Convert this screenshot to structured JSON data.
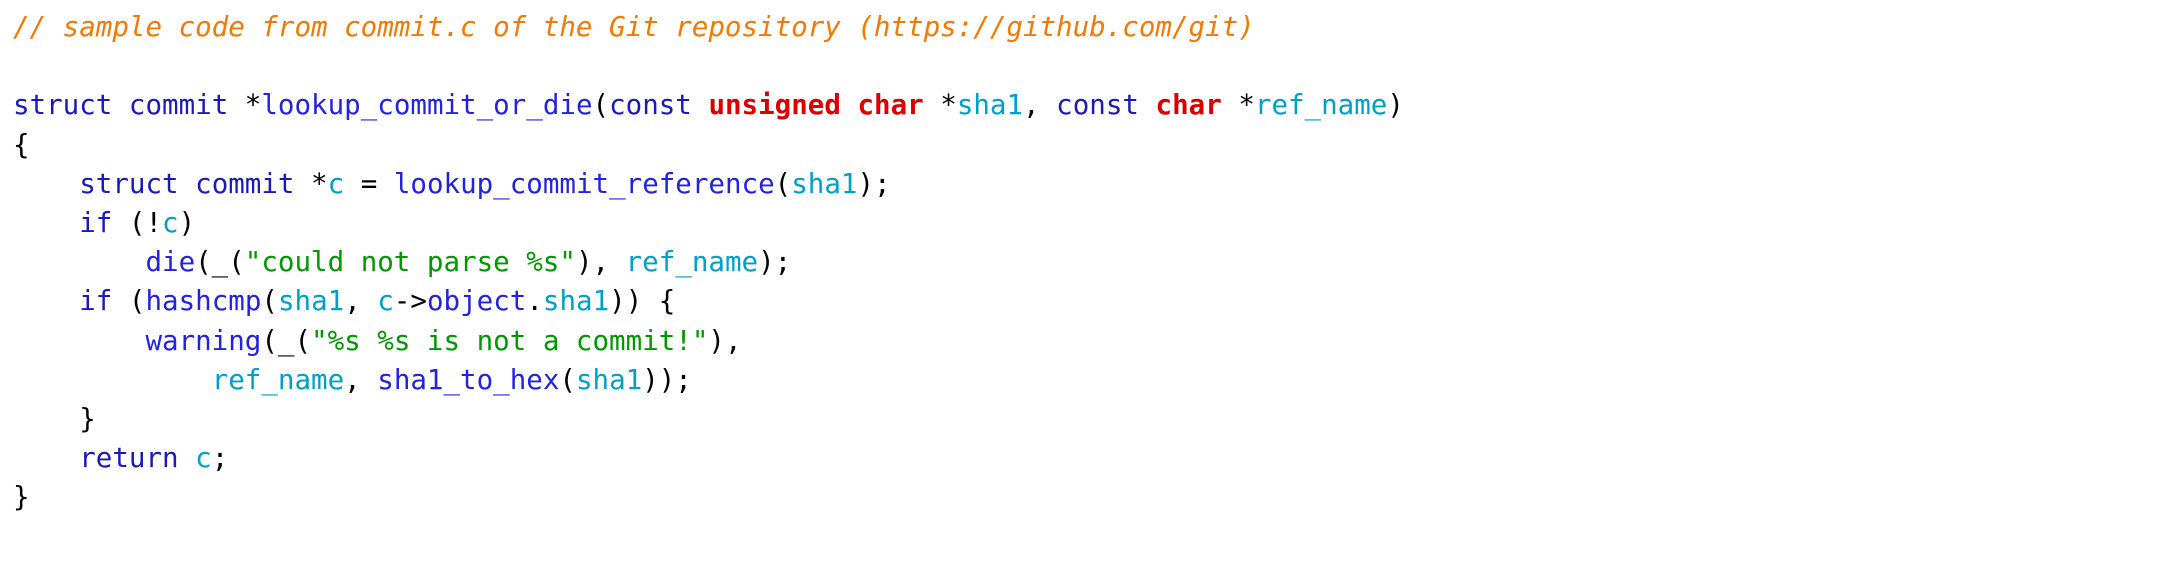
{
  "document": {
    "kind": "source-code-listing",
    "language": "C",
    "background_color": "#ffffff",
    "font_size_px": 27.5,
    "line_height_px": 39.2
  },
  "palette": {
    "comment": "#f57900",
    "keyword_type": "#1a1aba",
    "keyword_bold": "#dd0000",
    "function": "#2222e0",
    "variable": "#00a0c8",
    "string": "#009900",
    "punctuation": "#000000",
    "plain": "#000000"
  },
  "code": {
    "lines": [
      {
        "id": "line-1",
        "tokens": [
          {
            "t": "// sample code from commit.c of the Git repository (https://github.com/git)",
            "c": "comment",
            "i": true
          }
        ]
      },
      {
        "id": "line-2",
        "tokens": [
          {
            "t": "",
            "c": "plain"
          }
        ]
      },
      {
        "id": "line-3",
        "tokens": [
          {
            "t": "struct",
            "c": "keyword_type"
          },
          {
            "t": " ",
            "c": "plain"
          },
          {
            "t": "commit",
            "c": "keyword_type"
          },
          {
            "t": " *",
            "c": "punctuation"
          },
          {
            "t": "lookup_commit_or_die",
            "c": "function"
          },
          {
            "t": "(",
            "c": "punctuation"
          },
          {
            "t": "const",
            "c": "keyword_type"
          },
          {
            "t": " ",
            "c": "plain"
          },
          {
            "t": "unsigned",
            "c": "keyword_bold",
            "b": true
          },
          {
            "t": " ",
            "c": "plain"
          },
          {
            "t": "char",
            "c": "keyword_bold",
            "b": true
          },
          {
            "t": " *",
            "c": "punctuation"
          },
          {
            "t": "sha1",
            "c": "variable"
          },
          {
            "t": ", ",
            "c": "punctuation"
          },
          {
            "t": "const",
            "c": "keyword_type"
          },
          {
            "t": " ",
            "c": "plain"
          },
          {
            "t": "char",
            "c": "keyword_bold",
            "b": true
          },
          {
            "t": " *",
            "c": "punctuation"
          },
          {
            "t": "ref_name",
            "c": "variable"
          },
          {
            "t": ")",
            "c": "punctuation"
          }
        ]
      },
      {
        "id": "line-4",
        "tokens": [
          {
            "t": "{",
            "c": "punctuation"
          }
        ]
      },
      {
        "id": "line-5",
        "tokens": [
          {
            "t": "    ",
            "c": "plain"
          },
          {
            "t": "struct",
            "c": "keyword_type"
          },
          {
            "t": " ",
            "c": "plain"
          },
          {
            "t": "commit",
            "c": "keyword_type"
          },
          {
            "t": " *",
            "c": "punctuation"
          },
          {
            "t": "c",
            "c": "variable"
          },
          {
            "t": " = ",
            "c": "punctuation"
          },
          {
            "t": "lookup_commit_reference",
            "c": "function"
          },
          {
            "t": "(",
            "c": "punctuation"
          },
          {
            "t": "sha1",
            "c": "variable"
          },
          {
            "t": ");",
            "c": "punctuation"
          }
        ]
      },
      {
        "id": "line-6",
        "tokens": [
          {
            "t": "    ",
            "c": "plain"
          },
          {
            "t": "if",
            "c": "keyword_type"
          },
          {
            "t": " (!",
            "c": "punctuation"
          },
          {
            "t": "c",
            "c": "variable"
          },
          {
            "t": ")",
            "c": "punctuation"
          }
        ]
      },
      {
        "id": "line-7",
        "tokens": [
          {
            "t": "        ",
            "c": "plain"
          },
          {
            "t": "die",
            "c": "function"
          },
          {
            "t": "(_(",
            "c": "punctuation"
          },
          {
            "t": "\"could not parse %s\"",
            "c": "string"
          },
          {
            "t": "), ",
            "c": "punctuation"
          },
          {
            "t": "ref_name",
            "c": "variable"
          },
          {
            "t": ");",
            "c": "punctuation"
          }
        ]
      },
      {
        "id": "line-8",
        "tokens": [
          {
            "t": "    ",
            "c": "plain"
          },
          {
            "t": "if",
            "c": "keyword_type"
          },
          {
            "t": " (",
            "c": "punctuation"
          },
          {
            "t": "hashcmp",
            "c": "function"
          },
          {
            "t": "(",
            "c": "punctuation"
          },
          {
            "t": "sha1",
            "c": "variable"
          },
          {
            "t": ", ",
            "c": "punctuation"
          },
          {
            "t": "c",
            "c": "variable"
          },
          {
            "t": "->",
            "c": "punctuation"
          },
          {
            "t": "object",
            "c": "function"
          },
          {
            "t": ".",
            "c": "punctuation"
          },
          {
            "t": "sha1",
            "c": "variable"
          },
          {
            "t": ")) {",
            "c": "punctuation"
          }
        ]
      },
      {
        "id": "line-9",
        "tokens": [
          {
            "t": "        ",
            "c": "plain"
          },
          {
            "t": "warning",
            "c": "function"
          },
          {
            "t": "(_(",
            "c": "punctuation"
          },
          {
            "t": "\"%s %s is not a commit!\"",
            "c": "string"
          },
          {
            "t": "),",
            "c": "punctuation"
          }
        ]
      },
      {
        "id": "line-10",
        "tokens": [
          {
            "t": "            ",
            "c": "plain"
          },
          {
            "t": "ref_name",
            "c": "variable"
          },
          {
            "t": ", ",
            "c": "punctuation"
          },
          {
            "t": "sha1_to_hex",
            "c": "function"
          },
          {
            "t": "(",
            "c": "punctuation"
          },
          {
            "t": "sha1",
            "c": "variable"
          },
          {
            "t": "));",
            "c": "punctuation"
          }
        ]
      },
      {
        "id": "line-11",
        "tokens": [
          {
            "t": "    }",
            "c": "punctuation"
          }
        ]
      },
      {
        "id": "line-12",
        "tokens": [
          {
            "t": "    ",
            "c": "plain"
          },
          {
            "t": "return",
            "c": "keyword_type"
          },
          {
            "t": " ",
            "c": "plain"
          },
          {
            "t": "c",
            "c": "variable"
          },
          {
            "t": ";",
            "c": "punctuation"
          }
        ]
      },
      {
        "id": "line-13",
        "tokens": [
          {
            "t": "}",
            "c": "punctuation"
          }
        ]
      }
    ]
  }
}
